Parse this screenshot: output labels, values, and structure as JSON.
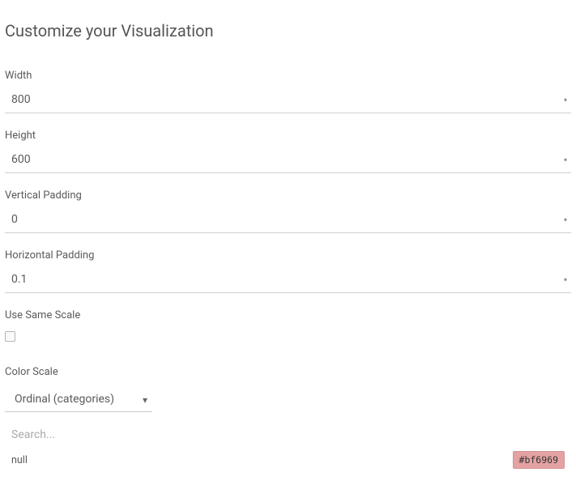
{
  "title": "Customize your Visualization",
  "fields": {
    "width": {
      "label": "Width",
      "value": "800"
    },
    "height": {
      "label": "Height",
      "value": "600"
    },
    "vpad": {
      "label": "Vertical Padding",
      "value": "0"
    },
    "hpad": {
      "label": "Horizontal Padding",
      "value": "0.1"
    },
    "samescale": {
      "label": "Use Same Scale",
      "checked": false
    },
    "colorscale": {
      "label": "Color Scale",
      "selected": "Ordinal (categories)"
    }
  },
  "search": {
    "placeholder": "Search..."
  },
  "colorItems": [
    {
      "name": "null",
      "hex": "#bf6969",
      "bg": "#e4a2a2"
    }
  ]
}
